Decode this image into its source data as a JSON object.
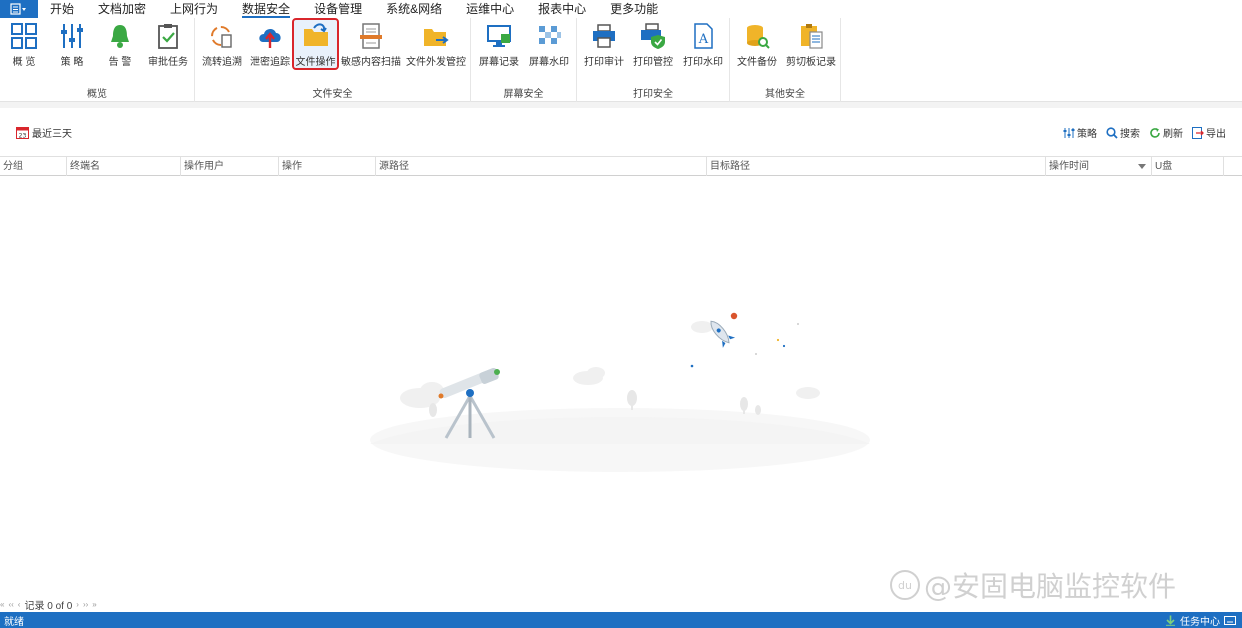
{
  "menubar": {
    "tabs": [
      {
        "label": "开始"
      },
      {
        "label": "文档加密"
      },
      {
        "label": "上网行为"
      },
      {
        "label": "数据安全"
      },
      {
        "label": "设备管理"
      },
      {
        "label": "系统&网络"
      },
      {
        "label": "运维中心"
      },
      {
        "label": "报表中心"
      },
      {
        "label": "更多功能"
      }
    ],
    "active_tab": "数据安全"
  },
  "ribbon": {
    "groups": [
      {
        "label": "概览",
        "buttons": [
          {
            "label": "概 览"
          },
          {
            "label": "策 略"
          },
          {
            "label": "告 警"
          },
          {
            "label": "审批任务"
          }
        ]
      },
      {
        "label": "文件安全",
        "buttons": [
          {
            "label": "流转追溯"
          },
          {
            "label": "泄密追踪"
          },
          {
            "label": "文件操作"
          },
          {
            "label": "敏感内容扫描"
          },
          {
            "label": "文件外发管控"
          }
        ]
      },
      {
        "label": "屏幕安全",
        "buttons": [
          {
            "label": "屏幕记录"
          },
          {
            "label": "屏幕水印"
          }
        ]
      },
      {
        "label": "打印安全",
        "buttons": [
          {
            "label": "打印审计"
          },
          {
            "label": "打印管控"
          },
          {
            "label": "打印水印"
          }
        ]
      },
      {
        "label": "其他安全",
        "buttons": [
          {
            "label": "文件备份"
          },
          {
            "label": "剪切板记录"
          }
        ]
      }
    ],
    "selected_button": "文件操作"
  },
  "toolbar": {
    "date_filter": "最近三天",
    "calendar_day": "23",
    "strategy": "策略",
    "search": "搜索",
    "refresh": "刷新",
    "export": "导出"
  },
  "grid": {
    "columns": [
      "分组",
      "终端名",
      "操作用户",
      "操作",
      "源路径",
      "目标路径",
      "操作时间",
      "U盘"
    ],
    "rows": []
  },
  "pager": {
    "text": "记录 0 of 0"
  },
  "watermark": {
    "text": "@安固电脑监控软件",
    "badge": "du"
  },
  "statusbar": {
    "status": "就绪",
    "task_center": "任务中心"
  },
  "colors": {
    "accent": "#1e6fc2",
    "selected_outline": "#d9262c"
  }
}
